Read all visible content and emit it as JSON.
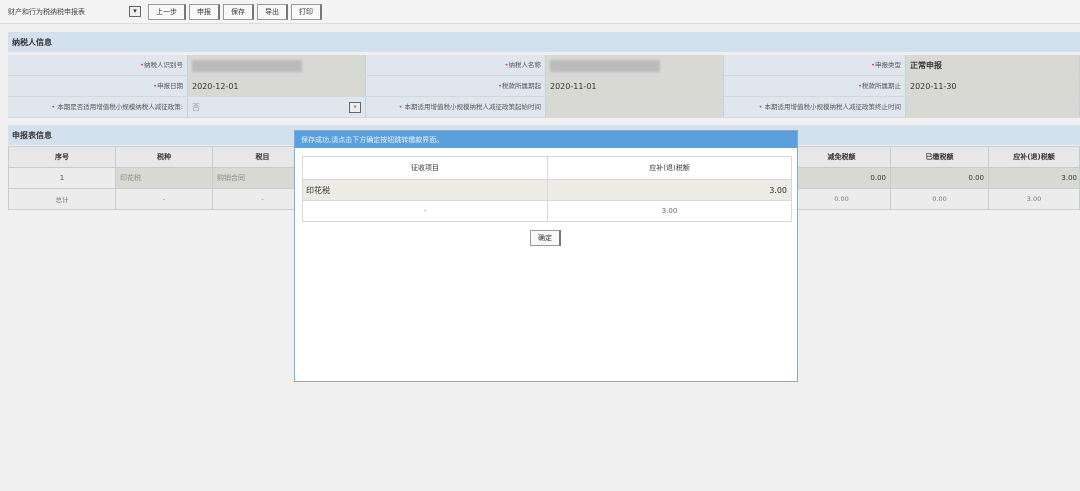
{
  "toolbar": {
    "form_select": "财产和行为税纳税申报表",
    "buttons": [
      "上一步",
      "申报",
      "保存",
      "导出",
      "打印"
    ]
  },
  "taxpayer": {
    "title": "纳税人信息",
    "fields": [
      {
        "label": "纳税人识别号",
        "value": ""
      },
      {
        "label": "纳税人名称",
        "value": ""
      },
      {
        "label": "申报类型",
        "value": "正常申报"
      },
      {
        "label": "申报日期",
        "value": "2020-12-01"
      },
      {
        "label": "税款所属期起",
        "value": "2020-11-01"
      },
      {
        "label": "税款所属期止",
        "value": "2020-11-30"
      },
      {
        "label": "本期是否适用增值税小规模纳税人减征政策:",
        "value": "否"
      },
      {
        "label": "本期适用增值税小规模纳税人减征政策起始时间",
        "value": ""
      },
      {
        "label": "本期适用增值税小规模纳税人减征政策终止时间",
        "value": ""
      }
    ]
  },
  "declaration": {
    "title": "申报表信息",
    "headers": [
      "序号",
      "税种",
      "税目",
      "减免税额",
      "已缴税额",
      "应补(退)税额"
    ],
    "row": [
      "1",
      "印花税",
      "购销合同",
      "0.00",
      "0.00",
      "3.00"
    ],
    "total": [
      "总计",
      "-",
      "-",
      "0.00",
      "0.00",
      "3.00"
    ]
  },
  "dialog": {
    "title": "保存成功,请点击下方确定按钮跳转缴款界面。",
    "headers": [
      "征收项目",
      "应补(退)税额"
    ],
    "row": [
      "印花税",
      "3.00"
    ],
    "total": [
      "-",
      "3.00"
    ],
    "ok": "确定"
  }
}
